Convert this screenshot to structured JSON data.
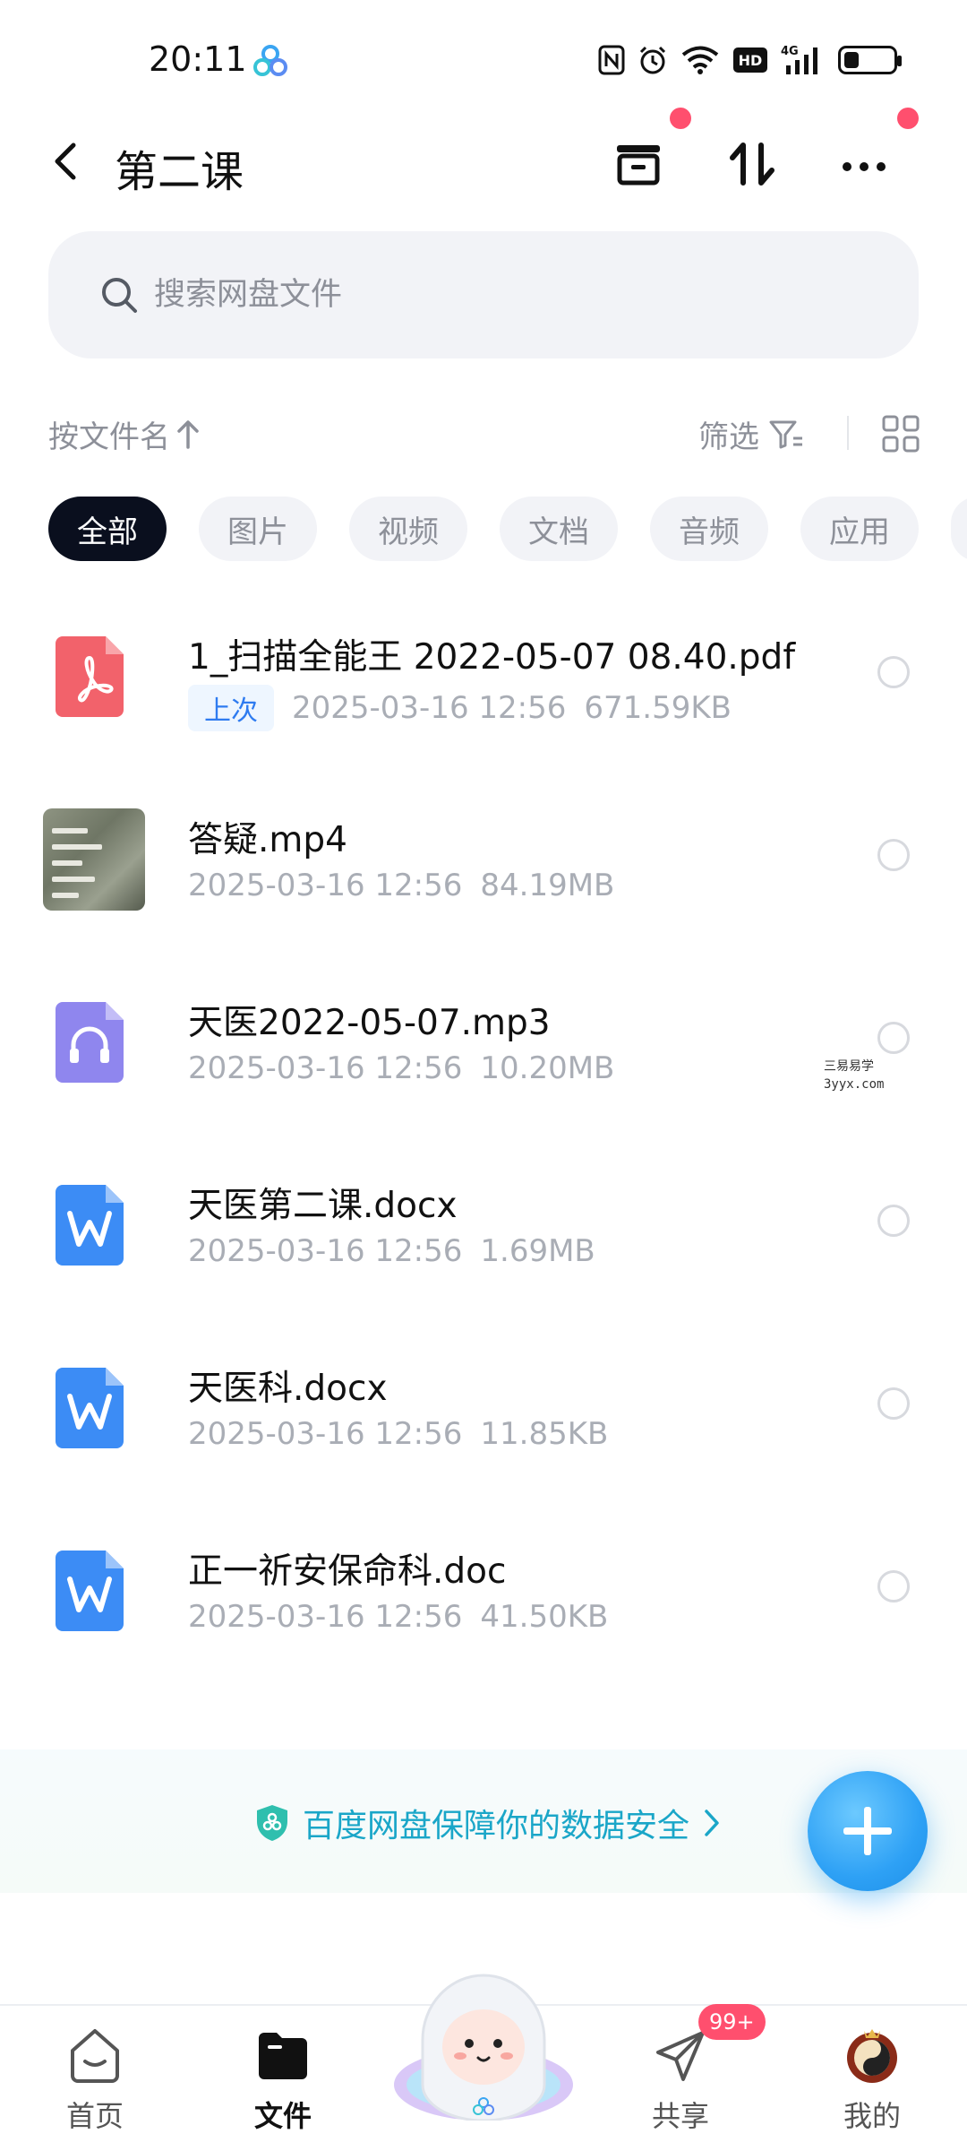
{
  "status_bar": {
    "time": "20:11",
    "icons": [
      "nfc-icon",
      "alarm-icon",
      "wifi-icon",
      "hd-icon",
      "4g-signal-icon",
      "battery-icon"
    ],
    "signal_label": "4G",
    "hd_label": "HD",
    "battery_level": 0.3
  },
  "header": {
    "title": "第二课",
    "back_icon": "chevron-left-icon",
    "actions": [
      "archive-icon",
      "sort-icon",
      "more-icon"
    ]
  },
  "search": {
    "placeholder": "搜索网盘文件"
  },
  "sort_bar": {
    "sort_label": "按文件名",
    "filter_label": "筛选"
  },
  "chips": [
    {
      "label": "全部",
      "active": true
    },
    {
      "label": "图片",
      "active": false
    },
    {
      "label": "视频",
      "active": false
    },
    {
      "label": "文档",
      "active": false
    },
    {
      "label": "音频",
      "active": false
    },
    {
      "label": "应用",
      "active": false
    }
  ],
  "files": [
    {
      "name": "1_扫描全能王 2022-05-07 08.40.pdf",
      "tag": "上次",
      "date": "2025-03-16  12:56",
      "size": "671.59KB",
      "icon": "pdf-icon"
    },
    {
      "name": "答疑.mp4",
      "date": "2025-03-16  12:56",
      "size": "84.19MB",
      "icon": "video-thumbnail"
    },
    {
      "name": "天医2022-05-07.mp3",
      "date": "2025-03-16  12:56",
      "size": "10.20MB",
      "icon": "audio-icon"
    },
    {
      "name": "天医第二课.docx",
      "date": "2025-03-16  12:56",
      "size": "1.69MB",
      "icon": "word-icon"
    },
    {
      "name": "天医科.docx",
      "date": "2025-03-16  12:56",
      "size": "11.85KB",
      "icon": "word-icon"
    },
    {
      "name": "正一祈安保命科.doc",
      "date": "2025-03-16  12:56",
      "size": "41.50KB",
      "icon": "word-icon"
    }
  ],
  "watermark": {
    "line1": "三易易学",
    "line2": "3yyx.com"
  },
  "banner": {
    "text": "百度网盘保障你的数据安全"
  },
  "bottom_nav": {
    "home": "首页",
    "files": "文件",
    "share": "共享",
    "share_badge": "99+",
    "me": "我的"
  },
  "colors": {
    "accent": "#2ea1f5",
    "chip_active": "#0a0f1e",
    "red_dot": "#ff4f6e",
    "pdf": "#f2626b",
    "word": "#3c8cf5",
    "audio": "#8f86ee",
    "banner_text": "#1aa6c8"
  }
}
